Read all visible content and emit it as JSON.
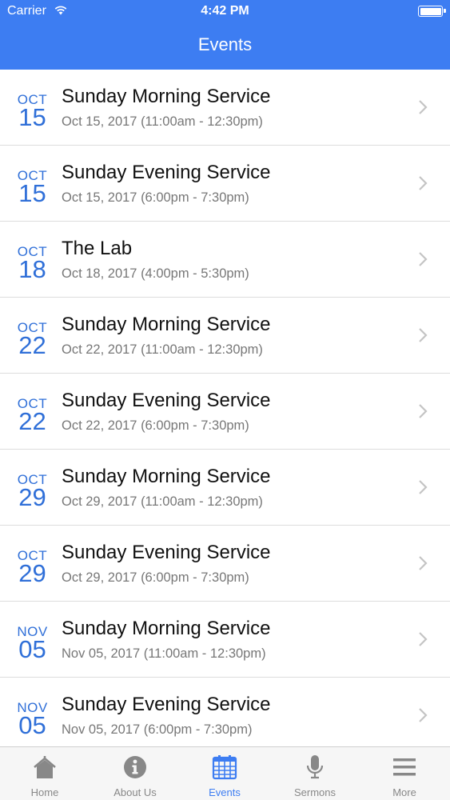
{
  "status_bar": {
    "carrier": "Carrier",
    "time": "4:42 PM"
  },
  "header": {
    "title": "Events"
  },
  "colors": {
    "accent": "#3d7df2",
    "date": "#2f6fd8",
    "tab_inactive": "#888888"
  },
  "events": [
    {
      "month": "OCT",
      "day": "15",
      "title": "Sunday Morning Service",
      "subtitle": "Oct 15, 2017 (11:00am - 12:30pm)"
    },
    {
      "month": "OCT",
      "day": "15",
      "title": "Sunday Evening Service",
      "subtitle": "Oct 15, 2017 (6:00pm - 7:30pm)"
    },
    {
      "month": "OCT",
      "day": "18",
      "title": "The Lab",
      "subtitle": "Oct 18, 2017 (4:00pm - 5:30pm)"
    },
    {
      "month": "OCT",
      "day": "22",
      "title": "Sunday Morning Service",
      "subtitle": "Oct 22, 2017 (11:00am - 12:30pm)"
    },
    {
      "month": "OCT",
      "day": "22",
      "title": "Sunday Evening Service",
      "subtitle": "Oct 22, 2017 (6:00pm - 7:30pm)"
    },
    {
      "month": "OCT",
      "day": "29",
      "title": "Sunday Morning Service",
      "subtitle": "Oct 29, 2017 (11:00am - 12:30pm)"
    },
    {
      "month": "OCT",
      "day": "29",
      "title": "Sunday Evening Service",
      "subtitle": "Oct 29, 2017 (6:00pm - 7:30pm)"
    },
    {
      "month": "NOV",
      "day": "05",
      "title": "Sunday Morning Service",
      "subtitle": "Nov 05, 2017 (11:00am - 12:30pm)"
    },
    {
      "month": "NOV",
      "day": "05",
      "title": "Sunday Evening Service",
      "subtitle": "Nov 05, 2017 (6:00pm - 7:30pm)"
    }
  ],
  "tabs": [
    {
      "label": "Home",
      "icon": "home-icon"
    },
    {
      "label": "About Us",
      "icon": "info-icon"
    },
    {
      "label": "Events",
      "icon": "calendar-icon",
      "active": true
    },
    {
      "label": "Sermons",
      "icon": "microphone-icon"
    },
    {
      "label": "More",
      "icon": "menu-icon"
    }
  ]
}
